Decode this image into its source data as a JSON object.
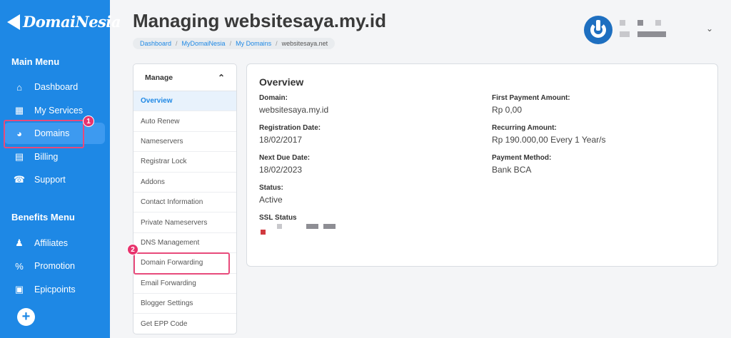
{
  "sidebar": {
    "brand": "DomaiNesia",
    "main_menu_title": "Main Menu",
    "main_items": [
      {
        "label": "Dashboard",
        "icon": "home-icon"
      },
      {
        "label": "My Services",
        "icon": "services-icon"
      },
      {
        "label": "Domains",
        "icon": "globe-icon"
      },
      {
        "label": "Billing",
        "icon": "billing-icon"
      },
      {
        "label": "Support",
        "icon": "headset-icon"
      }
    ],
    "benefits_menu_title": "Benefits Menu",
    "benefit_items": [
      {
        "label": "Affiliates",
        "icon": "affiliates-icon"
      },
      {
        "label": "Promotion",
        "icon": "percent-icon"
      },
      {
        "label": "Epicpoints",
        "icon": "gift-icon"
      }
    ],
    "add_button": "+"
  },
  "annotations": {
    "badge_1": "1",
    "badge_2": "2"
  },
  "header": {
    "title": "Managing websitesaya.my.id",
    "breadcrumbs": [
      "Dashboard",
      "MyDomaiNesia",
      "My Domains",
      "websitesaya.net"
    ]
  },
  "manage": {
    "title": "Manage",
    "items": [
      "Overview",
      "Auto Renew",
      "Nameservers",
      "Registrar Lock",
      "Addons",
      "Contact Information",
      "Private Nameservers",
      "DNS Management",
      "Domain Forwarding",
      "Email Forwarding",
      "Blogger Settings",
      "Get EPP Code"
    ]
  },
  "overview": {
    "title": "Overview",
    "domain_label": "Domain:",
    "domain_value": "websitesaya.my.id",
    "reg_label": "Registration Date:",
    "reg_value": "18/02/2017",
    "due_label": "Next Due Date:",
    "due_value": "18/02/2023",
    "status_label": "Status:",
    "status_value": "Active",
    "ssl_label": "SSL Status",
    "first_label": "First Payment Amount:",
    "first_value": "Rp 0,00",
    "recurring_label": "Recurring Amount:",
    "recurring_value": "Rp 190.000,00 Every 1 Year/s",
    "payment_label": "Payment Method:",
    "payment_value": "Bank BCA"
  },
  "colors": {
    "sidebar": "#1e88e5",
    "highlight": "#e84a7b",
    "ssl_status": "#d0393f"
  }
}
